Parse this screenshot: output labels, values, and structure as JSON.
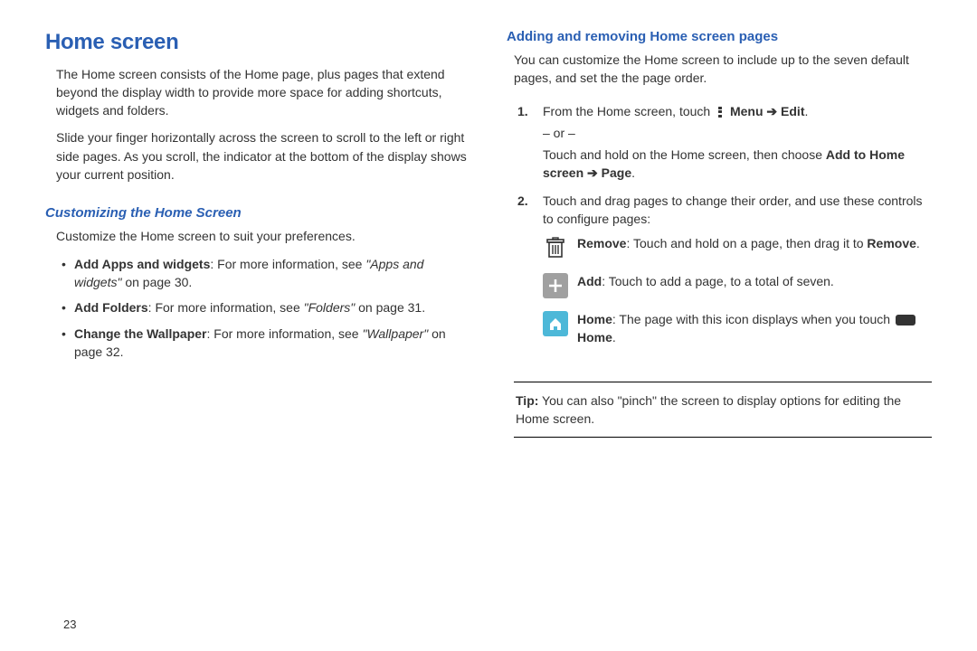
{
  "pageNumber": "23",
  "left": {
    "title": "Home screen",
    "para1": "The Home screen consists of the Home page, plus pages that extend beyond the display width to provide more space for adding shortcuts, widgets and folders.",
    "para2": "Slide your finger horizontally across the screen to scroll to the left or right side pages. As you scroll, the indicator at the bottom of the display shows your current position.",
    "subTitle": "Customizing the Home Screen",
    "para3": "Customize the Home screen to suit your preferences.",
    "bullets": {
      "b1": {
        "lead": "Add Apps and widgets",
        "mid": ": For more information, see ",
        "ref": "\"Apps and widgets\"",
        "tail": " on page 30."
      },
      "b2": {
        "lead": "Add Folders",
        "mid": ": For more information, see ",
        "ref": "\"Folders\"",
        "tail": " on page 31."
      },
      "b3": {
        "lead": "Change the Wallpaper",
        "mid": ": For more information, see ",
        "ref": "\"Wallpaper\"",
        "tail": " on page 32."
      }
    }
  },
  "right": {
    "heading": "Adding and removing Home screen pages",
    "para1": "You can customize the Home screen to include up to the seven default pages, and set the the page order.",
    "step1": {
      "pre": "From the Home screen, touch ",
      "menu": "Menu",
      "arrow": " ➔ ",
      "edit": "Edit",
      "post": ".",
      "or": "– or –",
      "alt_pre": "Touch and hold on the Home screen, then choose ",
      "alt_bold1": "Add to Home screen",
      "alt_arrow": " ➔ ",
      "alt_bold2": "Page",
      "alt_post": "."
    },
    "step2": {
      "text": "Touch and drag pages to change their order, and use these controls to configure pages:",
      "icons": {
        "remove": {
          "lead": "Remove",
          "mid": ": Touch and hold on a page, then drag it to ",
          "boldTail": "Remove",
          "post": "."
        },
        "add": {
          "lead": "Add",
          "text": ": Touch to add a page, to a total of seven."
        },
        "home": {
          "lead": "Home",
          "mid": ": The page with this icon displays when you touch ",
          "boldTail": "Home",
          "post": "."
        }
      }
    },
    "tip": {
      "lead": "Tip:",
      "text": " You can also \"pinch\" the screen to display options for editing the Home screen."
    }
  }
}
